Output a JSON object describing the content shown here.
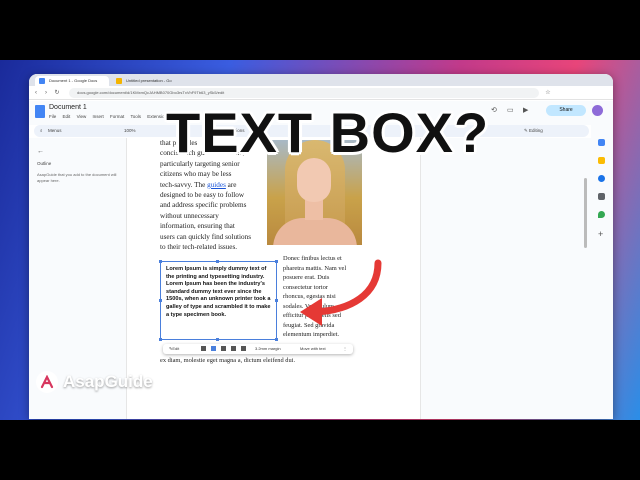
{
  "overlay": {
    "title": "TEXT BOX?",
    "brand": "AsapGuide"
  },
  "browser": {
    "tabs": [
      {
        "label": "Document 1 - Google Docs",
        "color": "#4285f4"
      },
      {
        "label": "Untitled presentation - Go",
        "color": "#f4b400"
      }
    ],
    "url": "docs.google.com/document/d/1KMxmQcJAHMB070Gbo3rsTxVhF9Tb63_ySk5/edit"
  },
  "docs": {
    "title": "Document 1",
    "menu": [
      "File",
      "Edit",
      "View",
      "Insert",
      "Format",
      "Tools",
      "Extensions",
      "Help"
    ],
    "share_label": "Share",
    "toolbar": {
      "mode": "Menus",
      "zoom": "100%",
      "options": "Options",
      "editing": "Editing"
    },
    "outline": {
      "back": "←",
      "heading": "Outline",
      "hint": "AsapGuide that you add to the document will appear here."
    }
  },
  "content": {
    "para1": [
      "that provides",
      "concise tech guides for users,",
      "particularly targeting senior",
      "citizens who may be less",
      "tech-savvy. The ",
      "guides",
      " are",
      "designed to  be easy to follow",
      "and address specific problems",
      "without  unnecessary",
      "information, ensuring that",
      "users can quickly find solutions",
      "to their tech-related issues."
    ],
    "textbox_text": "Lorem Ipsum is simply dummy text of the printing and typesetting industry. Lorem Ipsum has been the industry's standard dummy text ever since the 1500s, when an unknown printer took a galley of type and scrambled it to make a type specimen book.",
    "para2": [
      "Donec finibus lectus et",
      "pharetra mattis. Nam vel",
      "posuere erat. Duis",
      "consectetur tortor",
      "rhoncus, egestas nisi",
      "sodales. Vestibulum",
      "efficitur porta felis sed",
      "feugiat. Sed gravida",
      "elementum imperdiet."
    ],
    "para3": "ex diam, molestie eget magna a, dictum eleifend dui.",
    "textbox_toolbar": {
      "edit": "Edit",
      "margin": "3.2mm margin",
      "move": "Move with text"
    }
  },
  "colors": {
    "accent_blue": "#4a7fdc",
    "arrow_red": "#e53935",
    "share_bg": "#c2e7ff"
  },
  "icons": [
    "back-icon",
    "forward-icon",
    "refresh-icon",
    "star-icon",
    "docs-icon",
    "history-icon",
    "comment-icon",
    "video-icon",
    "pencil-icon",
    "calendar-icon",
    "keep-icon",
    "tasks-icon",
    "maps-icon",
    "plus-icon",
    "red-arrow-icon",
    "asapguide-logo-icon"
  ]
}
